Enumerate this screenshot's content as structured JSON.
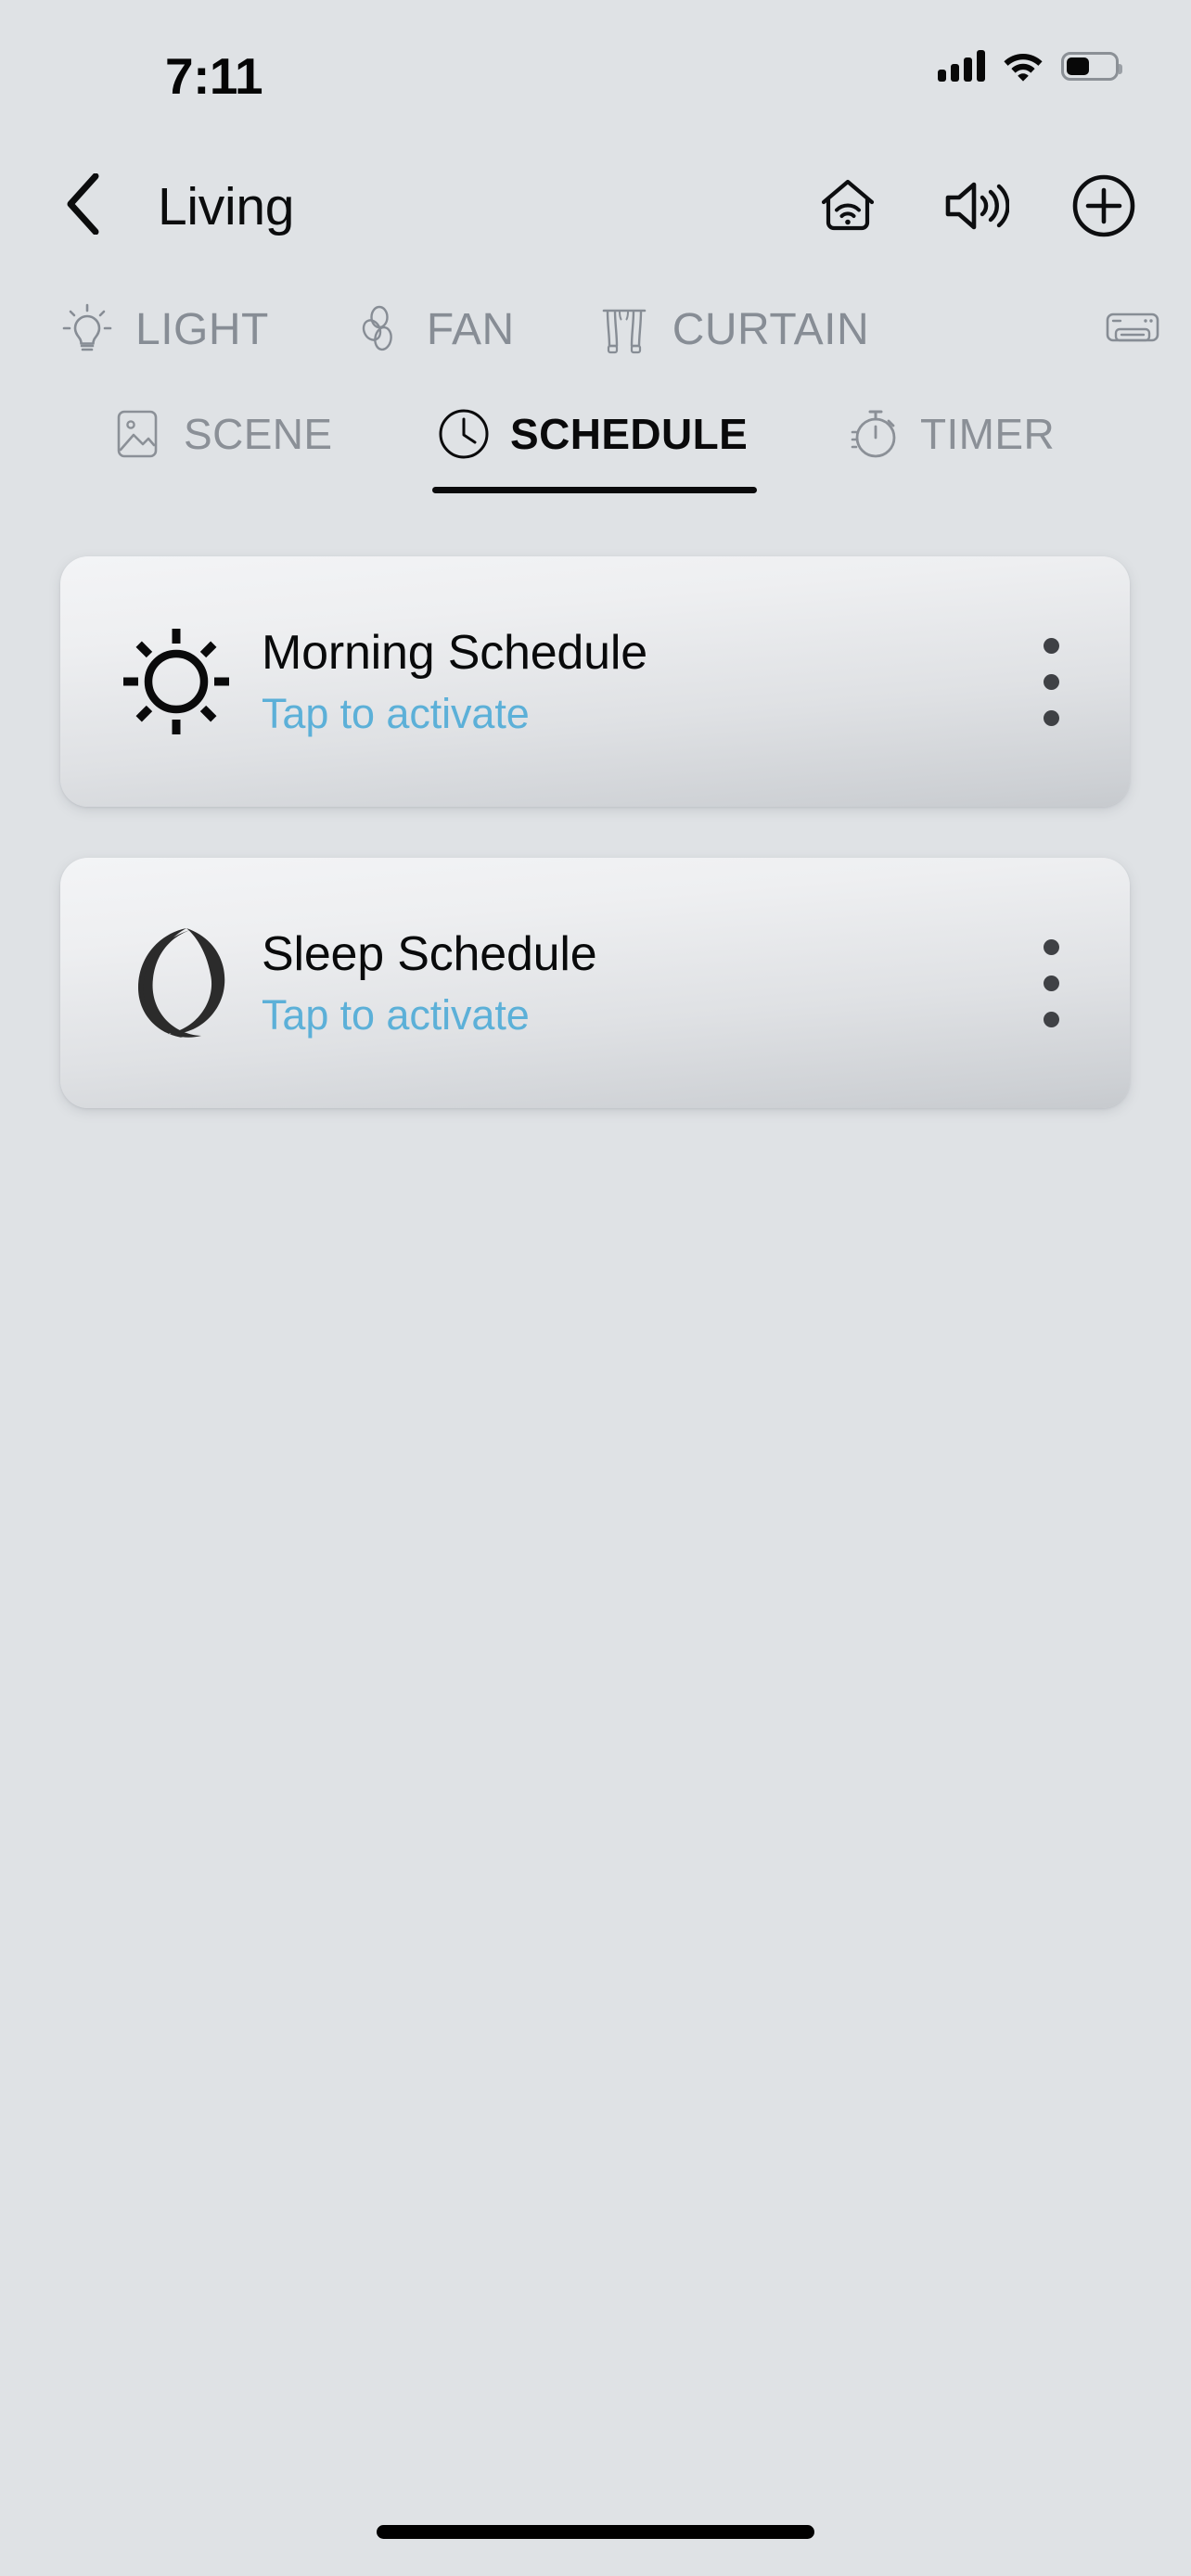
{
  "status_bar": {
    "time": "7:11",
    "signal_icon": "cellular-signal-icon",
    "signal_bars_filled": 4,
    "wifi_icon": "wifi-icon",
    "battery_icon": "battery-icon",
    "battery_level_percent": 43
  },
  "nav": {
    "back_icon": "chevron-left-icon",
    "title": "Living",
    "actions": [
      {
        "name": "home-wifi-icon",
        "label": "Home"
      },
      {
        "name": "speaker-icon",
        "label": "Speaker"
      },
      {
        "name": "add-circle-icon",
        "label": "Add"
      }
    ]
  },
  "category_tabs": {
    "active": "LIGHT",
    "items": [
      {
        "label": "LIGHT",
        "icon": "lightbulb-icon"
      },
      {
        "label": "FAN",
        "icon": "fan-blades-icon"
      },
      {
        "label": "CURTAIN",
        "icon": "curtain-icon"
      }
    ],
    "overflow_icon": "air-conditioner-icon"
  },
  "sub_tabs": {
    "active": "SCHEDULE",
    "items": [
      {
        "label": "SCENE",
        "icon": "image-icon",
        "active": false
      },
      {
        "label": "SCHEDULE",
        "icon": "clock-icon",
        "active": true
      },
      {
        "label": "TIMER",
        "icon": "stopwatch-icon",
        "active": false
      }
    ]
  },
  "schedules": [
    {
      "title": "Morning Schedule",
      "subtitle": "Tap to activate",
      "icon": "sun-icon",
      "menu_icon": "more-vertical-icon"
    },
    {
      "title": "Sleep Schedule",
      "subtitle": "Tap to activate",
      "icon": "moon-icon",
      "menu_icon": "more-vertical-icon"
    }
  ],
  "colors": {
    "background": "#dfe2e5",
    "accent_blue": "#5cb0d8",
    "text_primary": "#0a0a0b",
    "text_muted": "#8b9097",
    "card_top": "#f3f4f6",
    "card_bottom": "#c7cace"
  },
  "home_indicator": "home-indicator"
}
